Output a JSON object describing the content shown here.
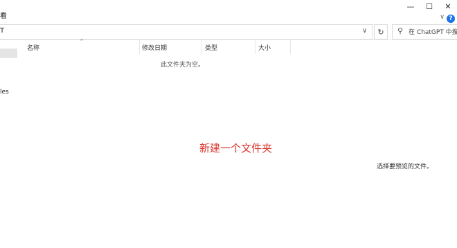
{
  "window": {
    "title_fragment": "看",
    "minimize_label": "—",
    "maximize_label": "☐",
    "close_label": "✕",
    "ribbon_chevron": "∨",
    "help_label": "?"
  },
  "address": {
    "path_fragment": "T",
    "dropdown_chevron": "∨",
    "refresh_glyph": "↻",
    "search_icon": "⚲",
    "search_placeholder": "在 ChatGPT 中搜索"
  },
  "nav": {
    "item_fragment": "les"
  },
  "columns": {
    "sort_caret": "^",
    "name": "名称",
    "modified": "修改日期",
    "type": "类型",
    "size": "大小"
  },
  "content": {
    "empty_message": "此文件夹为空。",
    "center_text": "新建一个文件夹",
    "preview_message": "选择要预览的文件。"
  },
  "colors": {
    "accent": "#1a73e8",
    "annotation_red": "#d9342b"
  }
}
